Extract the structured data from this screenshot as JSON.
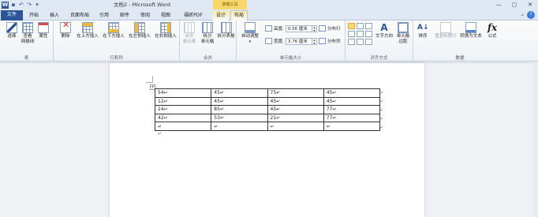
{
  "titlebar": {
    "title": "文档2 - Microsoft Word",
    "context_tab": "表格工具",
    "quick_access": [
      "save",
      "undo",
      "redo",
      "customize"
    ],
    "window_controls": [
      "—",
      "▢",
      "✕"
    ]
  },
  "tabs": [
    "文件",
    "开始",
    "插入",
    "页面布局",
    "引用",
    "邮件",
    "审阅",
    "视图",
    "福昕PDF",
    "设计",
    "布局"
  ],
  "active_tab": "布局",
  "ribbon": {
    "table_group": {
      "label": "表",
      "buttons": [
        "选择",
        "查看\n网格线",
        "属性"
      ]
    },
    "rows_cols_group": {
      "label": "行和列",
      "buttons": [
        "删除",
        "在上方插入",
        "在下方插入",
        "在左侧插入",
        "在右侧插入"
      ]
    },
    "merge_group": {
      "label": "合并",
      "buttons": [
        "合并\n单元格",
        "拆分\n单元格",
        "拆分表格"
      ]
    },
    "cell_size_group": {
      "label": "单元格大小",
      "autofit": "自动调整",
      "height_label": "高度:",
      "height_value": "0.56 厘米",
      "width_label": "宽度:",
      "width_value": "3.76 厘米",
      "distribute_rows": "分布行",
      "distribute_cols": "分布列"
    },
    "alignment_group": {
      "label": "对齐方式",
      "buttons": [
        "文字方向",
        "单元格\n边距"
      ]
    },
    "data_group": {
      "label": "数据",
      "buttons": [
        "排序",
        "重复标题行",
        "转换为文本",
        "公式"
      ]
    }
  },
  "table": {
    "rows": [
      [
        "54↵",
        "45↵",
        "75↵",
        "45↵"
      ],
      [
        "12↵",
        "45↵",
        "45↵",
        "45↵"
      ],
      [
        "24↵",
        "85↵",
        "45↵",
        "77↵"
      ],
      [
        "42↵",
        "53↵",
        "21↵",
        "77↵"
      ],
      [
        "↵",
        "↵",
        "↵",
        "↵"
      ]
    ],
    "row_end_mark": "↵",
    "after_table_mark": "↵"
  }
}
